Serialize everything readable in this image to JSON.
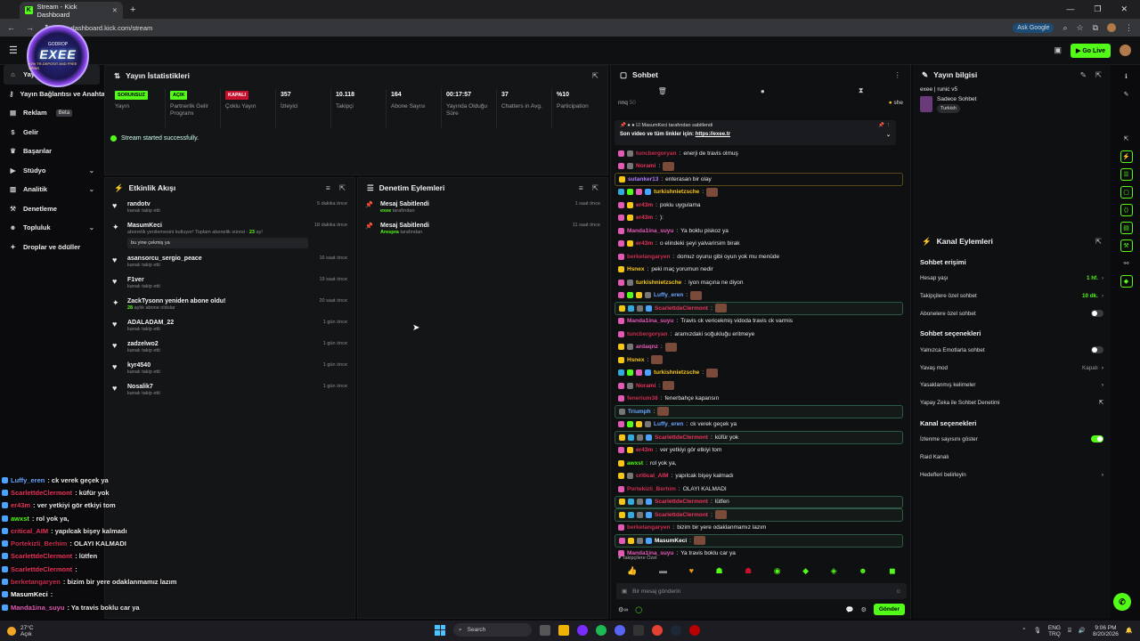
{
  "browser": {
    "tab_title": "Stream - Kick Dashboard",
    "url": "dashboard.kick.com/stream",
    "ask_google": "Ask Google"
  },
  "topbar": {
    "go_live": "Go Live"
  },
  "logo": {
    "line1": "GODROP",
    "name": "EXEE",
    "line3": "+2% TR-DEPOSIT AND FREE SPINS"
  },
  "sidebar": {
    "items": [
      {
        "label": "Yayın",
        "icon": "home-icon"
      },
      {
        "label": "Yayın Bağlantısı ve Anahtarı",
        "icon": "key-icon"
      },
      {
        "label": "Reklam",
        "icon": "ad-icon",
        "badge": "Beta"
      },
      {
        "label": "Gelir",
        "icon": "dollar-icon"
      },
      {
        "label": "Başarılar",
        "icon": "trophy-icon"
      },
      {
        "label": "Stüdyo",
        "icon": "video-icon",
        "chevron": true
      },
      {
        "label": "Analitik",
        "icon": "chart-icon",
        "chevron": true
      },
      {
        "label": "Denetleme",
        "icon": "hammer-icon"
      },
      {
        "label": "Topluluk",
        "icon": "users-icon",
        "chevron": true
      },
      {
        "label": "Droplar ve ödüller",
        "icon": "gift-icon"
      }
    ]
  },
  "stats": {
    "title": "Yayın İstatistikleri",
    "items": [
      {
        "badge": "SORUNSUZ",
        "badge_type": "green",
        "label": "Yayın"
      },
      {
        "badge": "AÇIK",
        "badge_type": "green",
        "label": "Partnerlik Gelir Programı"
      },
      {
        "badge": "KAPALI",
        "badge_type": "red",
        "label": "Çoklu Yayın"
      },
      {
        "value": "357",
        "label": "İzleyici"
      },
      {
        "value": "10.118",
        "label": "Takipçi"
      },
      {
        "value": "164",
        "label": "Abone Sayısı"
      },
      {
        "value": "00:17:57",
        "label": "Yayında Olduğu Süre"
      },
      {
        "value": "37",
        "label": "Chatters in Avg."
      },
      {
        "value": "%10",
        "label": "Participation"
      }
    ],
    "success": "Stream started successfully."
  },
  "activity": {
    "title": "Etkinlik Akışı",
    "items": [
      {
        "name": "randotv",
        "sub": "kanalı takip etti",
        "time": "5 dakika önce",
        "icon": "heart"
      },
      {
        "name": "MasumKeci",
        "sub": "abonelik yenilemesini kutluyor! Toplam abonelik süresi - ",
        "sub_num": "23",
        "sub_end": " ay!",
        "time": "18 dakika önce",
        "icon": "star",
        "message": "bu yine çekmiş ya"
      },
      {
        "name": "asansorcu_sergio_peace",
        "sub": "kanalı takip etti",
        "time": "16 saat önce",
        "icon": "heart"
      },
      {
        "name": "F1ver",
        "sub": "kanalı takip etti",
        "time": "19 saat önce",
        "icon": "heart"
      },
      {
        "name": "ZackTysonn yeniden abone oldu!",
        "sub_num": "28",
        "sub_end": " aylık abone oldular",
        "time": "20 saat önce",
        "icon": "star"
      },
      {
        "name": "ADALADAM_22",
        "sub": "kanalı takip etti",
        "time": "1 gün önce",
        "icon": "heart"
      },
      {
        "name": "zadzelwo2",
        "sub": "kanalı takip etti",
        "time": "1 gün önce",
        "icon": "heart"
      },
      {
        "name": "kyr4540",
        "sub": "kanalı takip etti",
        "time": "1 gün önce",
        "icon": "heart"
      },
      {
        "name": "Nosalik7",
        "sub": "kanalı takip etti",
        "time": "1 gün önce",
        "icon": "heart"
      }
    ]
  },
  "moderation": {
    "title": "Denetim Eylemleri",
    "items": [
      {
        "action": "Mesaj Sabitlendi",
        "by": "exee",
        "by_sfx": " tarafından",
        "time": "1 saat önce"
      },
      {
        "action": "Mesaj Sabitlendi",
        "by": "Arespra",
        "by_sfx": " tarafından",
        "time": "11 saat önce"
      }
    ]
  },
  "chat": {
    "title": "Sohbet",
    "top_user": "nnq",
    "top_count": "50",
    "top_right": "she",
    "pinned_by": "MasumKeci tarafından sabitlendi",
    "pinned_text": "Son video ve tüm linkler için: ",
    "pinned_link": "https://exee.tr",
    "messages": [
      {
        "user": "tuncbergoryan",
        "color": "#c92d4e",
        "text": "enerji de travis olmuş",
        "b": [
          "#e35ab5",
          "#777"
        ]
      },
      {
        "user": "Norami",
        "color": "#e8335a",
        "text": "",
        "emote": true,
        "b": [
          "#e35ab5",
          "#777"
        ]
      },
      {
        "user": "sutanker13",
        "color": "#b07bff",
        "text": "enterasan bir olay",
        "b": [
          "#f5c518"
        ],
        "hl": "hl2"
      },
      {
        "user": "turkishnietzsche",
        "color": "#f5c518",
        "text": "",
        "emote": true,
        "b": [
          "#3ad",
          "#53fc18",
          "#e35ab5",
          "#4aa3ff"
        ]
      },
      {
        "user": "er43m",
        "color": "#e8335a",
        "text": "pokiu uygulama",
        "b": [
          "#e35ab5",
          "#f5c518"
        ]
      },
      {
        "user": "er43m",
        "color": "#e8335a",
        "text": "):",
        "b": [
          "#e35ab5",
          "#f5c518"
        ]
      },
      {
        "user": "Manda1ina_suyu",
        "color": "#e35ab5",
        "text": "Ya boklu piskoz ya",
        "b": [
          "#e35ab5"
        ]
      },
      {
        "user": "er43m",
        "color": "#e8335a",
        "text": "o elindeki şeyi yalvarirsim birak",
        "b": [
          "#e35ab5",
          "#f5c518"
        ]
      },
      {
        "user": "berketangaryen",
        "color": "#c92d4e",
        "text": "domuz oyunu gibi oyun yok mu menüde",
        "b": [
          "#e35ab5"
        ]
      },
      {
        "user": "Hsnex",
        "color": "#f5c518",
        "text": "peki maç yorumun nedir",
        "b": [
          "#f5c518"
        ]
      },
      {
        "user": "turkishnietzsche",
        "color": "#f5c518",
        "text": "iyon maçına ne diyon",
        "b": [
          "#e35ab5",
          "#777"
        ]
      },
      {
        "user": "Luffy_eren",
        "color": "#6aa8ff",
        "text": "",
        "emote": true,
        "b": [
          "#e35ab5",
          "#53fc18",
          "#f5c518",
          "#777"
        ]
      },
      {
        "user": "ScarlettdeClermont",
        "color": "#e8335a",
        "text": "",
        "emote": true,
        "b": [
          "#f5c518",
          "#3ad",
          "#777",
          "#4aa3ff"
        ],
        "hl": "hl"
      },
      {
        "user": "Manda1ina_suyu",
        "color": "#e35ab5",
        "text": "Travis ck vericekmiş vidoda travis ck varmis",
        "b": [
          "#e35ab5"
        ]
      },
      {
        "user": "tuncbergoryan",
        "color": "#c92d4e",
        "text": "aramızdaki soğukluğu eritmeye",
        "b": [
          "#e35ab5"
        ]
      },
      {
        "user": "ardaqnz",
        "color": "#e35ab5",
        "text": "",
        "emote": true,
        "b": [
          "#f5c518",
          "#777"
        ]
      },
      {
        "user": "Hsnex",
        "color": "#f5c518",
        "text": "",
        "emote": true,
        "b": [
          "#f5c518"
        ]
      },
      {
        "user": "turkishnietzsche",
        "color": "#f5c518",
        "text": "",
        "emote": true,
        "b": [
          "#3ad",
          "#53fc18",
          "#e35ab5",
          "#4aa3ff"
        ]
      },
      {
        "user": "Norami",
        "color": "#e8335a",
        "text": "",
        "emote": true,
        "b": [
          "#e35ab5",
          "#777"
        ]
      },
      {
        "user": "fenerium38",
        "color": "#c92d4e",
        "text": "fenerbahçe kapansın",
        "b": [
          "#e35ab5"
        ]
      },
      {
        "user": "Triumph",
        "color": "#6aa8ff",
        "text": "",
        "emote": true,
        "b": [
          "#777"
        ],
        "hl": "hl"
      },
      {
        "user": "Luffy_eren",
        "color": "#6aa8ff",
        "text": "ck verek geçek ya",
        "b": [
          "#e35ab5",
          "#53fc18",
          "#f5c518",
          "#777"
        ]
      },
      {
        "user": "ScarlettdeClermont",
        "color": "#e8335a",
        "text": "küfür yok",
        "b": [
          "#f5c518",
          "#3ad",
          "#777",
          "#4aa3ff"
        ],
        "hl": "hl"
      },
      {
        "user": "er43m",
        "color": "#e8335a",
        "text": "ver yetkiyi gör etkiyi tom",
        "b": [
          "#e35ab5",
          "#f5c518"
        ]
      },
      {
        "user": "awxst",
        "color": "#53fc18",
        "text": "rol yok ya,",
        "b": [
          "#f5c518"
        ]
      },
      {
        "user": "critical_AIM",
        "color": "#e8335a",
        "text": "yapılcak bişey kalmadı",
        "b": [
          "#f5c518",
          "#777"
        ]
      },
      {
        "user": "Portekizli_Berhim",
        "color": "#c92d4e",
        "text": "OLAYI KALMADI",
        "b": [
          "#e35ab5"
        ]
      },
      {
        "user": "ScarlettdeClermont",
        "color": "#e8335a",
        "text": "lütfen",
        "b": [
          "#f5c518",
          "#3ad",
          "#777",
          "#4aa3ff"
        ],
        "hl": "hl"
      },
      {
        "user": "ScarlettdeClermont",
        "color": "#e8335a",
        "text": "",
        "emote": true,
        "b": [
          "#f5c518",
          "#3ad",
          "#777",
          "#4aa3ff"
        ],
        "hl": "hl"
      },
      {
        "user": "berketangaryen",
        "color": "#c92d4e",
        "text": "bizim bir yere odaklanmamız lazım",
        "b": [
          "#e35ab5"
        ]
      },
      {
        "user": "MasumKeci",
        "color": "#ffffff",
        "text": "",
        "emote": true,
        "b": [
          "#e35ab5",
          "#f5c518",
          "#777",
          "#4aa3ff"
        ],
        "hl": "hl"
      },
      {
        "user": "Manda1ina_suyu",
        "color": "#e35ab5",
        "text": "Ya travis boklu car ya",
        "b": [
          "#e35ab5"
        ]
      }
    ],
    "followers_only": "Takipçilere Özel",
    "placeholder": "Bir mesaj gönderin",
    "send": "Gönder"
  },
  "stream_info": {
    "title": "Yayın bilgisi",
    "stream_title": "exee | runic v5",
    "category": "Sadece Sohbet",
    "tag": "Turkish"
  },
  "channel_actions": {
    "title": "Kanal Eylemleri",
    "chat_access": "Sohbet erişimi",
    "access_items": [
      {
        "label": "Hesap yaşı",
        "value": "1 hf.",
        "green": true,
        "chevron": true
      },
      {
        "label": "Takipçilere özel sohbet",
        "value": "10 dk.",
        "green": true,
        "chevron": true
      },
      {
        "label": "Abonelere özel sohbet",
        "toggle": false
      }
    ],
    "chat_options": "Sohbet seçenekleri",
    "chat_items": [
      {
        "label": "Yalnızca Emotlarla sohbet",
        "toggle": false
      },
      {
        "label": "Yavaş mod",
        "value": "Kapalı",
        "chevron": true
      },
      {
        "label": "Yasaklanmış kelimeler",
        "chevron": true
      },
      {
        "label": "Yapay Zeka ile Sohbet Denetimi",
        "external": true
      }
    ],
    "channel_options": "Kanal seçenekleri",
    "channel_items": [
      {
        "label": "İzlenme sayısını göster",
        "toggle": true
      },
      {
        "label": "Raid Kanalı"
      },
      {
        "label": "Hedefleri belirleyin",
        "chevron": true
      }
    ]
  },
  "overlay_chat": [
    {
      "user": "Luffy_eren",
      "color": "#6aa8ff",
      "text": ": ck verek geçek ya"
    },
    {
      "user": "ScarlettdeClermont",
      "color": "#e8335a",
      "text": ": küfür yok"
    },
    {
      "user": "er43m",
      "color": "#e8335a",
      "text": ": ver yetkiyi gör etkiyi tom"
    },
    {
      "user": "awxst",
      "color": "#53fc18",
      "text": ": rol yok ya,"
    },
    {
      "user": "critical_AIM",
      "color": "#e8335a",
      "text": ": yapılcak bişey kalmadı"
    },
    {
      "user": "Portekizli_Berhim",
      "color": "#c92d4e",
      "text": ": OLAYI KALMADI"
    },
    {
      "user": "ScarlettdeClermont",
      "color": "#e8335a",
      "text": ": lütfen"
    },
    {
      "user": "ScarlettdeClermont",
      "color": "#e8335a",
      "text": ":"
    },
    {
      "user": "berketangaryen",
      "color": "#c92d4e",
      "text": ": bizim bir yere odaklanmamız lazım"
    },
    {
      "user": "MasumKeci",
      "color": "#ffffff",
      "text": ":"
    },
    {
      "user": "Manda1ina_suyu",
      "color": "#e35ab5",
      "text": ": Ya travis boklu car ya"
    }
  ],
  "taskbar": {
    "temp": "27°C",
    "weather": "Açık",
    "search": "Search",
    "lang1": "ENG",
    "lang2": "TRQ",
    "time": "9:06 PM",
    "date": "8/20/2026"
  }
}
